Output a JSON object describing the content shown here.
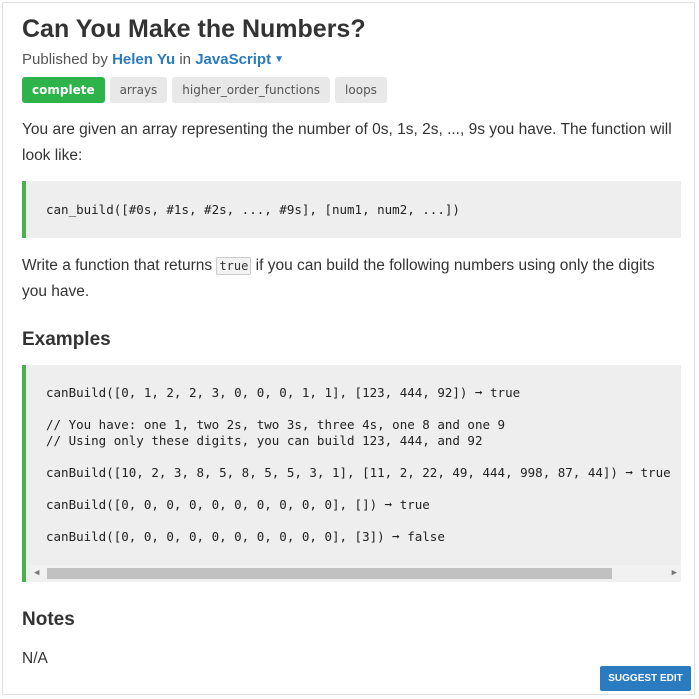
{
  "challenge": {
    "title": "Can You Make the Numbers?",
    "published_prefix": "Published by",
    "author": "Helen Yu",
    "in_word": "in",
    "language": "JavaScript"
  },
  "tags": [
    "complete",
    "arrays",
    "higher_order_functions",
    "loops"
  ],
  "description": {
    "intro": "You are given an array representing the number of 0s, 1s, 2s, ..., 9s you have. The function will look like:",
    "signature": "can_build([#0s, #1s, #2s, ..., #9s], [num1, num2, ...])",
    "task_before": "Write a function that returns",
    "task_code": "true",
    "task_after": "if you can build the following numbers using only the digits you have."
  },
  "examples": {
    "heading": "Examples",
    "lines": [
      "canBuild([0, 1, 2, 2, 3, 0, 0, 0, 1, 1], [123, 444, 92]) ➞ true",
      "// You have: one 1, two 2s, two 3s, three 4s, one 8 and one 9",
      "// Using only these digits, you can build 123, 444, and 92",
      "canBuild([10, 2, 3, 8, 5, 8, 5, 5, 3, 1], [11, 2, 22, 49, 444, 998, 87, 44]) ➞ true",
      "canBuild([0, 0, 0, 0, 0, 0, 0, 0, 0, 0], []) ➞ true",
      "canBuild([0, 0, 0, 0, 0, 0, 0, 0, 0, 0], [3]) ➞ false"
    ]
  },
  "notes": {
    "heading": "Notes",
    "text": "N/A"
  },
  "actions": {
    "suggest_edit": "SUGGEST EDIT"
  },
  "colors": {
    "accent": "#2a7bbf",
    "complete_tag": "#2db34a",
    "code_border": "#4caf50"
  }
}
